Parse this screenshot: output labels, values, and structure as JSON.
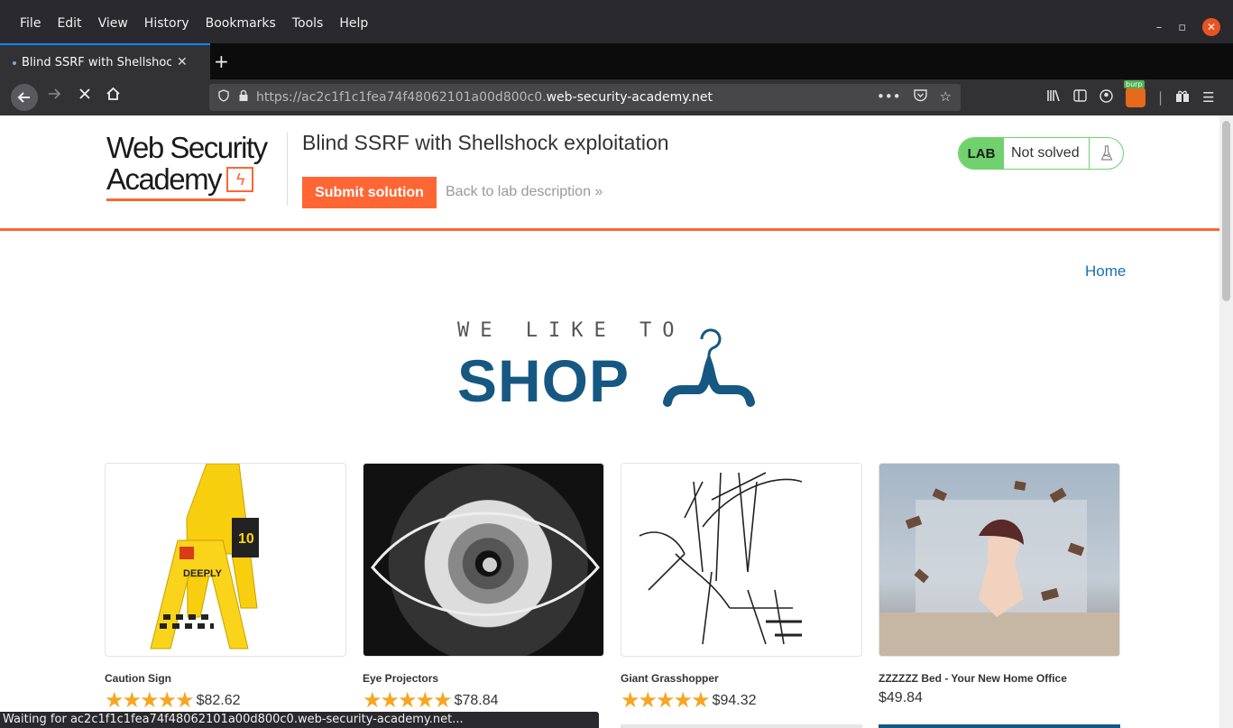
{
  "menu": {
    "items": [
      "File",
      "Edit",
      "View",
      "History",
      "Bookmarks",
      "Tools",
      "Help"
    ]
  },
  "window": {
    "minimize": "–",
    "restore": "▫",
    "close": "✕"
  },
  "tab": {
    "title": "Blind SSRF with Shellshock exploitation",
    "close": "✕",
    "new_tab": "+"
  },
  "navbar": {
    "url_prefix": "https://ac2c1f1c1fea74f48062101a00d800c0.",
    "url_domain": "web-security-academy.net",
    "burp_badge": "burp"
  },
  "lab": {
    "logo_line1": "Web Security",
    "logo_line2": "Academy",
    "title": "Blind SSRF with Shellshock exploitation",
    "submit_label": "Submit solution",
    "back_label": "Back to lab description »",
    "status_pill": "LAB",
    "status_text": "Not solved"
  },
  "nav": {
    "home": "Home"
  },
  "shop_logo": {
    "small": "WE LIKE TO",
    "big": "SHOP"
  },
  "products": [
    {
      "name": "Caution Sign",
      "stars": "★★★★★",
      "price": "$82.62"
    },
    {
      "name": "Eye Projectors",
      "stars": "★★★★★",
      "price": "$78.84"
    },
    {
      "name": "Giant Grasshopper",
      "stars": "★★★★★",
      "price": "$94.32"
    },
    {
      "name": "ZZZZZZ Bed - Your New Home Office",
      "stars": "",
      "price": "$49.84"
    }
  ],
  "status_bar": "Waiting for ac2c1f1c1fea74f48062101a00d800c0.web-security-academy.net...",
  "colors": {
    "accent": "#ff6633",
    "brand_blue": "#165882",
    "lab_green": "#70d16d",
    "star": "#f6a623"
  }
}
